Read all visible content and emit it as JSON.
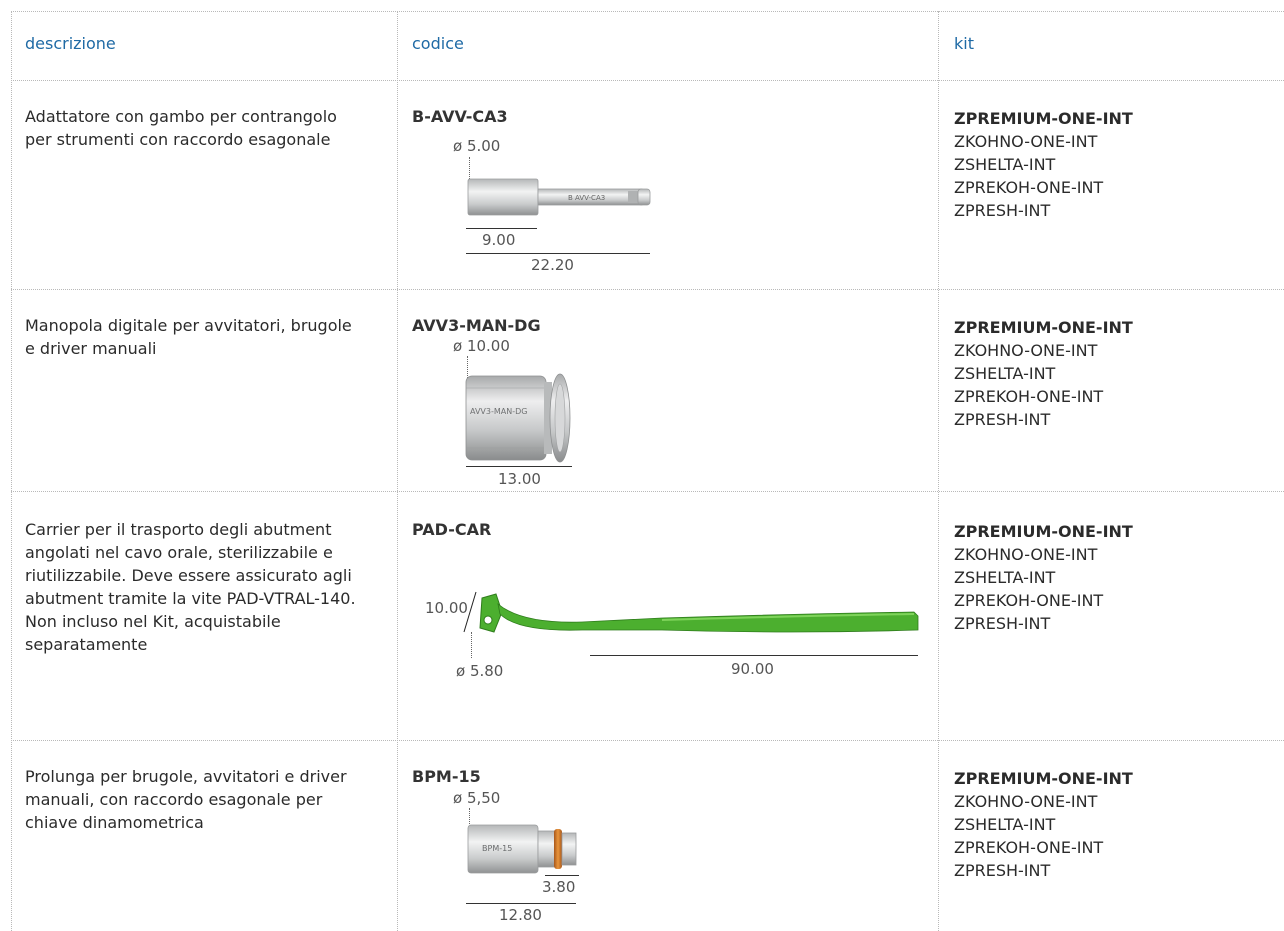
{
  "headers": {
    "descrizione": "descrizione",
    "codice": "codice",
    "kit": "kit"
  },
  "rows": [
    {
      "descrizione": "Adattatore con gambo per contrangolo per strumenti con raccordo esagonale",
      "codice": "B-AVV-CA3",
      "dims": [
        "ø 5.00",
        "9.00",
        "22.20"
      ],
      "engraving": "B AVV-CA3",
      "kit": [
        "ZPREMIUM-ONE-INT",
        "ZKOHNO-ONE-INT",
        "ZSHELTA-INT",
        "ZPREKOH-ONE-INT",
        "ZPRESH-INT"
      ]
    },
    {
      "descrizione": "Manopola digitale per avvitatori, brugole e driver manuali",
      "codice": "AVV3-MAN-DG",
      "dims": [
        "ø 10.00",
        "13.00"
      ],
      "engraving": "AVV3-MAN-DG",
      "kit": [
        "ZPREMIUM-ONE-INT",
        "ZKOHNO-ONE-INT",
        "ZSHELTA-INT",
        "ZPREKOH-ONE-INT",
        "ZPRESH-INT"
      ]
    },
    {
      "descrizione": "Carrier per il trasporto degli abutment angolati nel cavo orale, sterilizzabile e riutilizzabile. Deve essere assicurato agli abutment tramite la vite PAD-VTRAL-140. Non incluso nel Kit, acquistabile separatamente",
      "codice": "PAD-CAR",
      "dims": [
        "10.00",
        "ø 5.80",
        "90.00"
      ],
      "kit": [
        "ZPREMIUM-ONE-INT",
        "ZKOHNO-ONE-INT",
        "ZSHELTA-INT",
        "ZPREKOH-ONE-INT",
        "ZPRESH-INT"
      ]
    },
    {
      "descrizione": "Prolunga per brugole, avvitatori e driver manuali, con raccordo esagonale per chiave dinamometrica",
      "codice": "BPM-15",
      "dims": [
        "ø 5,50",
        "3.80",
        "12.80"
      ],
      "engraving": "BPM-15",
      "kit": [
        "ZPREMIUM-ONE-INT",
        "ZKOHNO-ONE-INT",
        "ZSHELTA-INT",
        "ZPREKOH-ONE-INT",
        "ZPRESH-INT"
      ]
    }
  ],
  "colors": {
    "header": "#1f6aa5",
    "carrier_green": "#4caf2f",
    "orange_ring": "#d9822b",
    "steel": "#c9cbcc"
  }
}
